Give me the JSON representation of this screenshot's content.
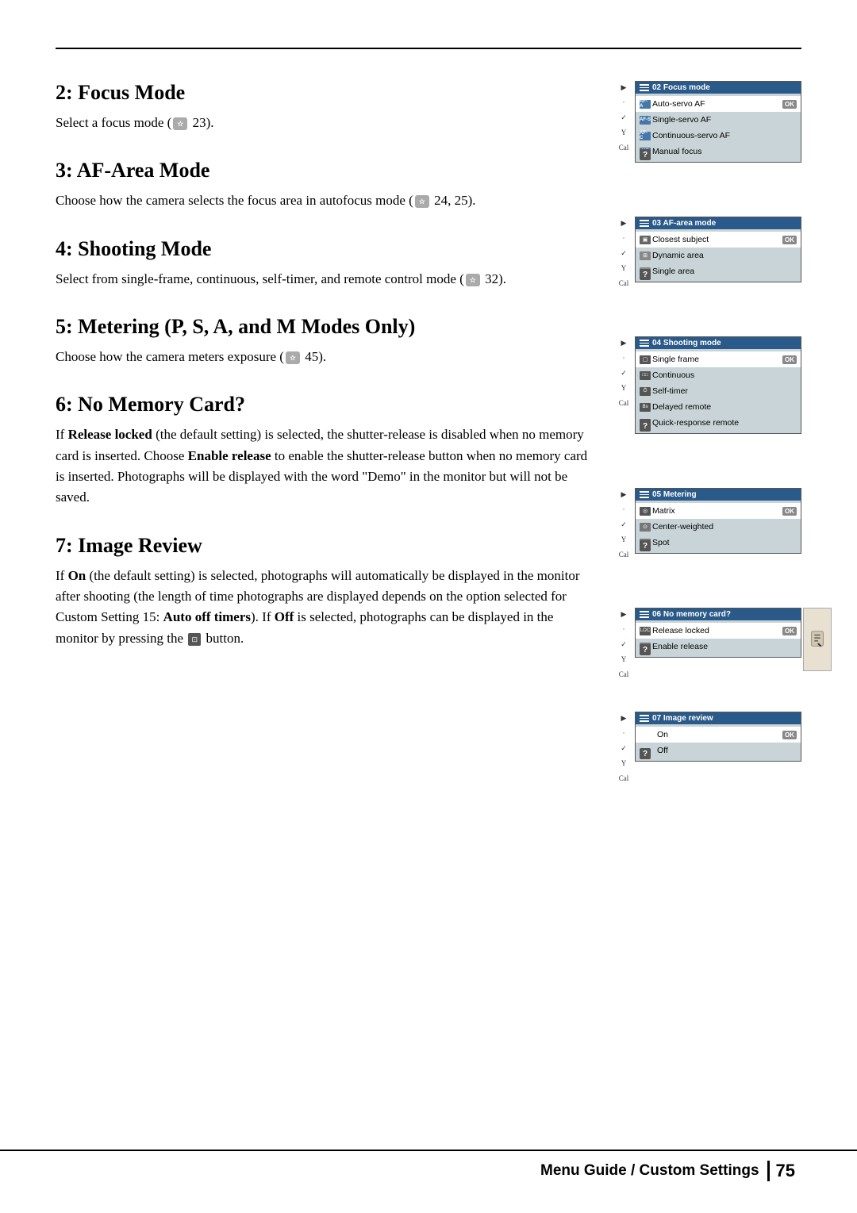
{
  "page": {
    "top_line": true,
    "footer": {
      "label": "Menu Guide / Custom Settings",
      "page_number": "75"
    }
  },
  "sections": [
    {
      "id": "focus-mode",
      "number": "2:",
      "title": "Focus Mode",
      "body": "Select a focus mode (",
      "body_ref": "23",
      "body_suffix": ").",
      "lcd": {
        "title": "02 Focus mode",
        "rows": [
          {
            "icon": "AF-A",
            "text": "Auto-servo AF",
            "selected": true,
            "ok": true
          },
          {
            "icon": "AF-S",
            "text": "Single-servo AF",
            "selected": false
          },
          {
            "icon": "AF-C",
            "text": "Continuous-servo AF",
            "selected": false
          },
          {
            "icon": "MF",
            "text": "Manual focus",
            "selected": false
          }
        ]
      }
    },
    {
      "id": "af-area-mode",
      "number": "3:",
      "title": "AF-Area Mode",
      "body": "Choose how the camera selects the focus area in autofocus mode (",
      "body_ref": "24, 25",
      "body_suffix": ").",
      "lcd": {
        "title": "03 AF-area mode",
        "rows": [
          {
            "icon": "▣",
            "text": "Closest subject",
            "selected": true,
            "ok": true
          },
          {
            "icon": "⊞",
            "text": "Dynamic area",
            "selected": false
          },
          {
            "icon": "⊡",
            "text": "Single area",
            "selected": false
          }
        ]
      }
    },
    {
      "id": "shooting-mode",
      "number": "4:",
      "title": "Shooting Mode",
      "body_parts": [
        {
          "text": "Select from single-frame, continuous, self-timer, and remote control mode (",
          "bold": false
        },
        {
          "text": "32",
          "ref": true
        },
        {
          "text": ").",
          "bold": false
        }
      ],
      "lcd": {
        "title": "04 Shooting mode",
        "rows": [
          {
            "icon": "▢",
            "text": "Single frame",
            "selected": true,
            "ok": true
          },
          {
            "icon": "□□",
            "text": "Continuous",
            "selected": false
          },
          {
            "icon": "⏱",
            "text": "Self-timer",
            "selected": false
          },
          {
            "icon": "Bs",
            "text": "Delayed remote",
            "selected": false
          },
          {
            "icon": "◈",
            "text": "Quick-response remote",
            "selected": false
          }
        ]
      }
    },
    {
      "id": "metering",
      "number": "5:",
      "title": "Metering (P, S, A, and M Modes Only)",
      "body": "Choose how the camera meters exposure (",
      "body_ref": "45",
      "body_suffix": ").",
      "lcd": {
        "title": "05 Metering",
        "rows": [
          {
            "icon": "◎",
            "text": "Matrix",
            "selected": true,
            "ok": true
          },
          {
            "icon": "⊙",
            "text": "Center-weighted",
            "selected": false
          },
          {
            "icon": "·",
            "text": "Spot",
            "selected": false
          }
        ]
      }
    },
    {
      "id": "no-memory-card",
      "number": "6:",
      "title": "No Memory Card?",
      "body_parts": [
        {
          "text": "If ",
          "bold": false
        },
        {
          "text": "Release locked",
          "bold": true
        },
        {
          "text": " (the default setting) is selected, the shutter-release is disabled when no memory card is inserted. Choose ",
          "bold": false
        },
        {
          "text": "Enable release",
          "bold": true
        },
        {
          "text": " to enable the shutter-release button when no memory card is inserted. Photographs will be displayed with the word “Demo” in the monitor but will not be saved.",
          "bold": false
        }
      ],
      "lcd": {
        "title": "06 No memory card?",
        "rows": [
          {
            "icon": "LOC",
            "text": "Release locked",
            "selected": true,
            "ok": true
          },
          {
            "icon": "OK",
            "text": "Enable release",
            "selected": false
          }
        ]
      },
      "right_tab": true
    },
    {
      "id": "image-review",
      "number": "7:",
      "title": "Image Review",
      "body_parts": [
        {
          "text": "If ",
          "bold": false
        },
        {
          "text": "On",
          "bold": true
        },
        {
          "text": " (the default setting) is selected, photographs will automatically be displayed in the monitor after shooting (the length of time photographs are displayed depends on the option selected for Custom Setting 15: ",
          "bold": false
        },
        {
          "text": "Auto off timers",
          "bold": true
        },
        {
          "text": "). If ",
          "bold": false
        },
        {
          "text": "Off",
          "bold": true
        },
        {
          "text": " is selected, photographs can be displayed in the monitor by pressing the ",
          "bold": false
        },
        {
          "text": "MONITOR_BTN",
          "monitor_btn": true
        },
        {
          "text": " button.",
          "bold": false
        }
      ],
      "lcd": {
        "title": "07 Image review",
        "rows": [
          {
            "icon": "",
            "text": "On",
            "selected": true,
            "ok": true
          },
          {
            "icon": "",
            "text": "Off",
            "selected": false
          }
        ]
      }
    }
  ]
}
